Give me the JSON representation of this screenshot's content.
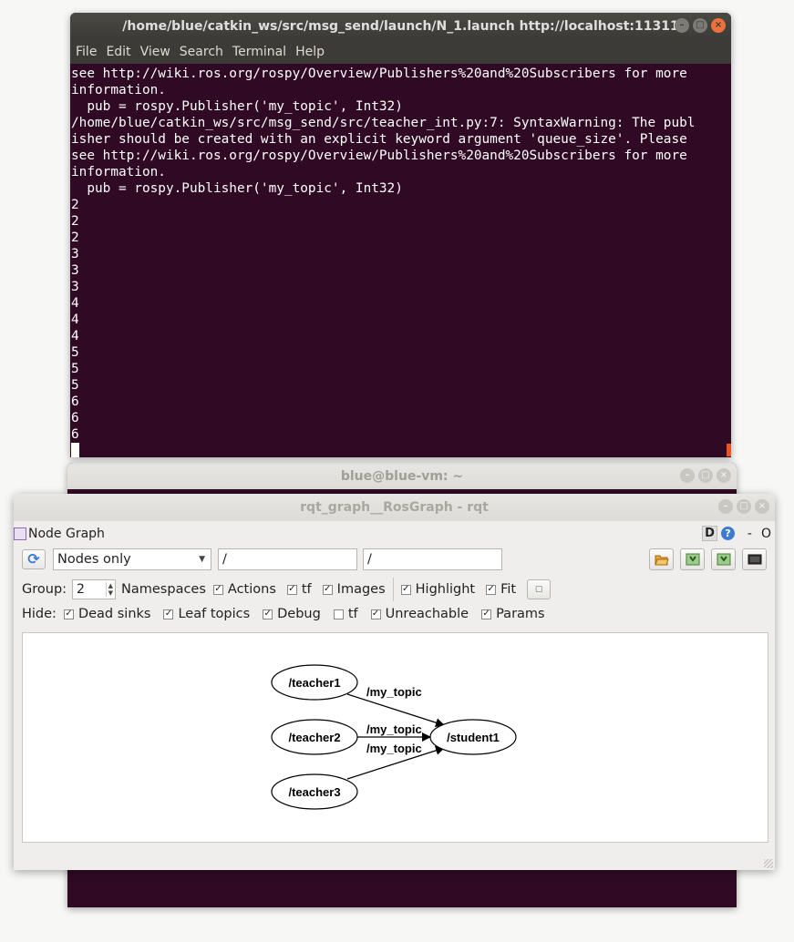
{
  "terminal_main": {
    "title": "/home/blue/catkin_ws/src/msg_send/launch/N_1.launch http://localhost:11311",
    "menu": [
      "File",
      "Edit",
      "View",
      "Search",
      "Terminal",
      "Help"
    ],
    "lines": [
      "see http://wiki.ros.org/rospy/Overview/Publishers%20and%20Subscribers for more",
      "information.",
      "  pub = rospy.Publisher('my_topic', Int32)",
      "/home/blue/catkin_ws/src/msg_send/src/teacher_int.py:7: SyntaxWarning: The publ",
      "isher should be created with an explicit keyword argument 'queue_size'. Please",
      "see http://wiki.ros.org/rospy/Overview/Publishers%20and%20Subscribers for more",
      "information.",
      "  pub = rospy.Publisher('my_topic', Int32)",
      "2",
      "2",
      "2",
      "3",
      "3",
      "3",
      "4",
      "4",
      "4",
      "5",
      "5",
      "5",
      "6",
      "6",
      "6"
    ]
  },
  "terminal_back": {
    "title": "blue@blue-vm: ~"
  },
  "rqt": {
    "title": "rqt_graph__RosGraph - rqt",
    "plugin_label": "Node Graph",
    "header_right": {
      "d_label": "D",
      "help_icon": "?",
      "minus_label": "-",
      "o_label": "O"
    },
    "toolbar": {
      "view_mode": "Nodes only",
      "filter_1": "/",
      "filter_2": "/",
      "tools": [
        "folder-open-icon",
        "save-dot-icon",
        "save-svg-icon",
        "screenshot-icon"
      ]
    },
    "group_row": {
      "group_label": "Group:",
      "group_value": "2",
      "options": [
        {
          "label": "Namespaces",
          "checked": true
        },
        {
          "label": "Actions",
          "checked": true
        },
        {
          "label": "tf",
          "checked": true
        },
        {
          "label": "Images",
          "checked": false
        },
        {
          "label": "Highlight",
          "checked": true
        },
        {
          "label": "Fit",
          "checked": false
        }
      ]
    },
    "hide_row": {
      "hide_label": "Hide:",
      "options": [
        {
          "label": "Dead sinks",
          "checked": true
        },
        {
          "label": "Leaf topics",
          "checked": true
        },
        {
          "label": "Debug",
          "checked": true
        },
        {
          "label": "tf",
          "checked": false
        },
        {
          "label": "Unreachable",
          "checked": true
        },
        {
          "label": "Params",
          "checked": true
        }
      ]
    },
    "graph": {
      "nodes": [
        "/teacher1",
        "/teacher2",
        "/teacher3",
        "/student1"
      ],
      "edges": [
        {
          "from": "/teacher1",
          "to": "/student1",
          "label": "/my_topic"
        },
        {
          "from": "/teacher2",
          "to": "/student1",
          "label": "/my_topic"
        },
        {
          "from": "/teacher3",
          "to": "/student1",
          "label": "/my_topic"
        }
      ]
    }
  }
}
